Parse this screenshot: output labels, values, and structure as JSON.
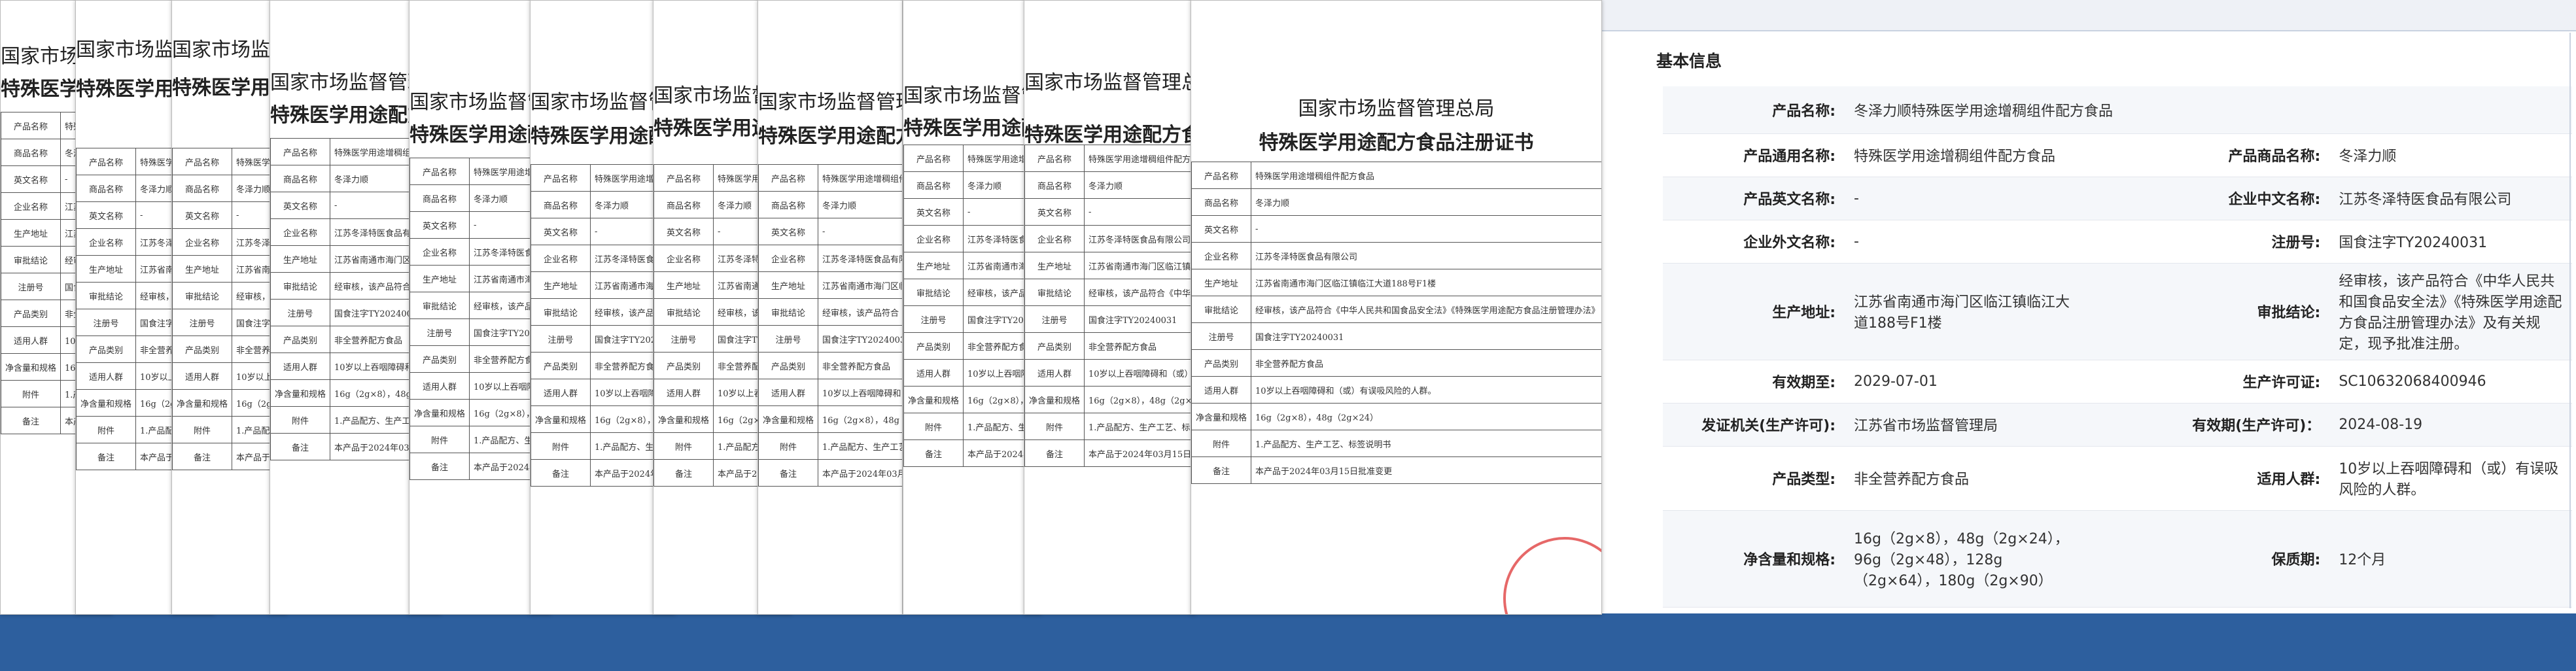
{
  "certificate": {
    "title_line1": "国家市场监督管理总局",
    "title_line2": "特殊医学用途配方食品注册证书",
    "rows": [
      {
        "label": "产品名称",
        "value": "特殊医学用途增稠组件配方食品"
      },
      {
        "label": "商品名称",
        "value": "冬泽力顺"
      },
      {
        "label": "英文名称",
        "value": "-"
      },
      {
        "label": "企业名称",
        "value": "江苏冬泽特医食品有限公司"
      },
      {
        "label": "生产地址",
        "value": "江苏省南通市海门区临江镇临江大道188号F1楼"
      },
      {
        "label": "审批结论",
        "value": "经审核，该产品符合《中华人民共和国食品安全法》《特殊医学用途配方食品注册管理办法》"
      },
      {
        "label": "注册号",
        "value": "国食注字TY20240031"
      },
      {
        "label": "产品类别",
        "value": "非全营养配方食品"
      },
      {
        "label": "适用人群",
        "value": "10岁以上吞咽障碍和（或）有误吸风险的人群。"
      },
      {
        "label": "净含量和规格",
        "value": "16g（2g×8），48g（2g×24）"
      },
      {
        "label": "附件",
        "value": "1.产品配方、生产工艺、标签说明书"
      },
      {
        "label": "备注",
        "value": "本产品于2024年03月15日批准变更"
      }
    ]
  },
  "info": {
    "title": "基本信息",
    "rows": [
      {
        "cells": [
          {
            "label": "产品名称:",
            "value": "冬泽力顺特殊医学用途增稠组件配方食品"
          }
        ]
      },
      {
        "cells": [
          {
            "label": "产品通用名称:",
            "value": "特殊医学用途增稠组件配方食品"
          },
          {
            "label": "产品商品名称:",
            "value": "冬泽力顺"
          }
        ]
      },
      {
        "cells": [
          {
            "label": "产品英文名称:",
            "value": "-"
          },
          {
            "label": "企业中文名称:",
            "value": "江苏冬泽特医食品有限公司"
          }
        ]
      },
      {
        "cells": [
          {
            "label": "企业外文名称:",
            "value": "-"
          },
          {
            "label": "注册号:",
            "value": "国食注字TY20240031"
          }
        ]
      },
      {
        "cells": [
          {
            "label": "生产地址:",
            "value": "江苏省南通市海门区临江镇临江大道188号F1楼"
          },
          {
            "label": "审批结论:",
            "value": "经审核，该产品符合《中华人民共和国食品安全法》《特殊医学用途配方食品注册管理办法》及有关规定，现予批准注册。"
          }
        ]
      },
      {
        "cells": [
          {
            "label": "有效期至:",
            "value": "2029-07-01"
          },
          {
            "label": "生产许可证:",
            "value": "SC10632068400946"
          }
        ]
      },
      {
        "cells": [
          {
            "label": "发证机关(生产许可):",
            "value": "江苏省市场监督管理局"
          },
          {
            "label": "有效期(生产许可)：",
            "value": "2024-08-19"
          }
        ]
      },
      {
        "cells": [
          {
            "label": "产品类型:",
            "value": "非全营养配方食品"
          },
          {
            "label": "适用人群:",
            "value": "10岁以上吞咽障碍和（或）有误吸风险的人群。"
          }
        ]
      },
      {
        "cells": [
          {
            "label": "净含量和规格:",
            "value": "16g（2g×8），48g（2g×24），96g（2g×48），128g（2g×64），180g（2g×90）"
          },
          {
            "label": "保质期:",
            "value": "12个月"
          }
        ]
      }
    ]
  }
}
